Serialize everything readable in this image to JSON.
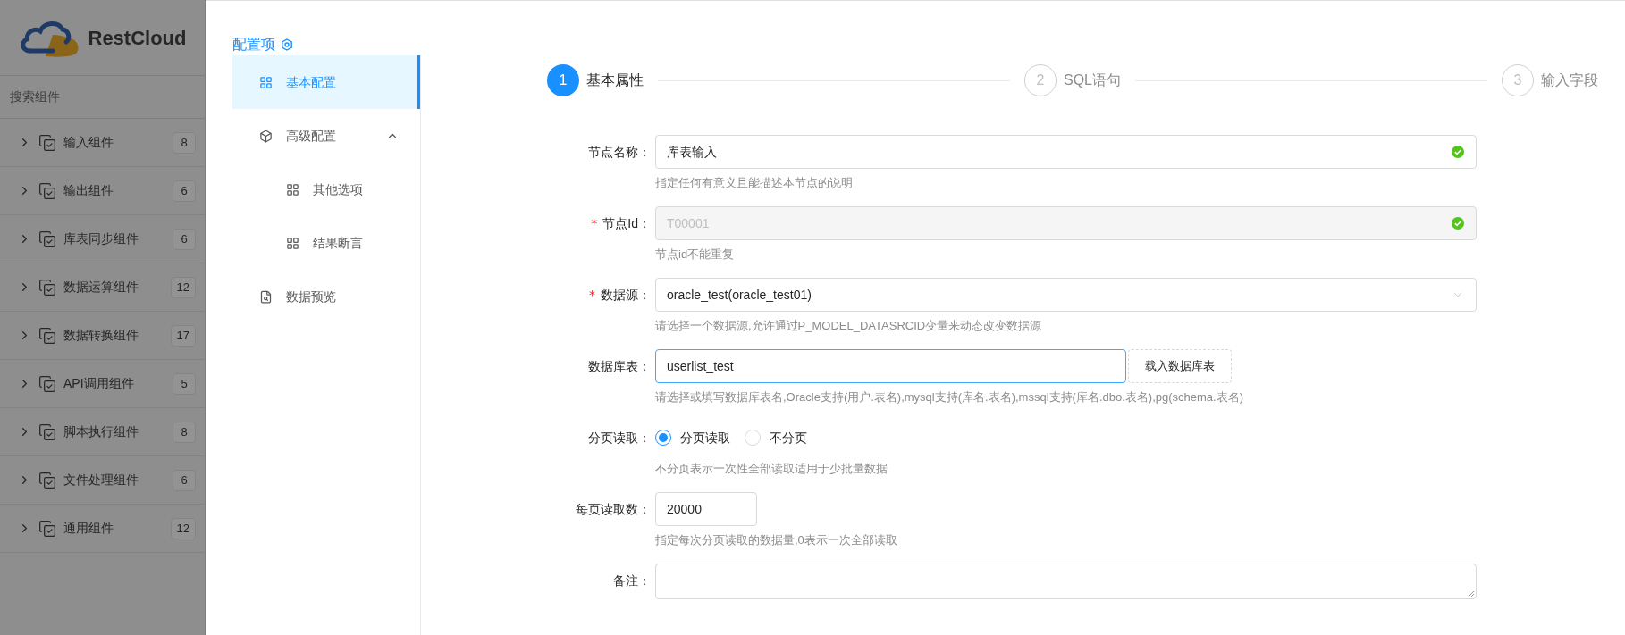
{
  "sidebar": {
    "logo_text": "RestCloud",
    "search": {
      "placeholder": "搜索组件"
    },
    "items": [
      {
        "label": "输入组件",
        "count": "8"
      },
      {
        "label": "输出组件",
        "count": "6"
      },
      {
        "label": "库表同步组件",
        "count": "6"
      },
      {
        "label": "数据运算组件",
        "count": "12"
      },
      {
        "label": "数据转换组件",
        "count": "17"
      },
      {
        "label": "API调用组件",
        "count": "5"
      },
      {
        "label": "脚本执行组件",
        "count": "8"
      },
      {
        "label": "文件处理组件",
        "count": "6"
      },
      {
        "label": "通用组件",
        "count": "12"
      }
    ]
  },
  "config_nav": {
    "title": "配置项",
    "items": [
      {
        "label": "基本配置",
        "kind": "grid",
        "selected": true
      },
      {
        "label": "高级配置",
        "kind": "cube",
        "selected": false,
        "expanded": true,
        "children": [
          {
            "label": "其他选项",
            "kind": "grid",
            "selected": false
          },
          {
            "label": "结果断言",
            "kind": "grid",
            "selected": false
          }
        ]
      },
      {
        "label": "数据预览",
        "kind": "preview",
        "selected": false
      }
    ]
  },
  "steps": [
    {
      "number": "1",
      "label": "基本属性",
      "selected": true
    },
    {
      "number": "2",
      "label": "SQL语句",
      "selected": false
    },
    {
      "number": "3",
      "label": "输入字段",
      "selected": false
    }
  ],
  "form": [
    {
      "kind": "text",
      "label": "节点名称：",
      "value": "库表输入",
      "valid": true,
      "disabled": false,
      "focused": false,
      "help": "指定任何有意义且能描述本节点的说明"
    },
    {
      "kind": "text",
      "required_mark": "*",
      "label": "节点Id：",
      "value": "T00001",
      "valid": true,
      "disabled": true,
      "focused": false,
      "help": "节点id不能重复"
    },
    {
      "kind": "select",
      "required_mark": "*",
      "label": "数据源：",
      "value": "oracle_test(oracle_test01)",
      "valid": false,
      "disabled": false,
      "focused": false,
      "help": "请选择一个数据源,允许通过P_MODEL_DATASRCID变量来动态改变数据源"
    },
    {
      "kind": "text_button",
      "label": "数据库表：",
      "value": "userlist_test",
      "valid": false,
      "disabled": false,
      "focused": true,
      "button": "载入数据库表",
      "help": "请选择或填写数据库表名,Oracle支持(用户.表名),mysql支持(库名.表名),mssql支持(库名.dbo.表名),pg(schema.表名)"
    },
    {
      "kind": "radio",
      "label": "分页读取：",
      "options": [
        {
          "label": "分页读取",
          "selected": true
        },
        {
          "label": "不分页",
          "selected": false
        }
      ],
      "help": "不分页表示一次性全部读取适用于少批量数据"
    },
    {
      "kind": "short_text",
      "label": "每页读取数：",
      "value": "20000",
      "valid": false,
      "disabled": false,
      "focused": false,
      "help": "指定每次分页读取的数据量,0表示一次全部读取"
    },
    {
      "kind": "textarea",
      "label": "备注："
    }
  ]
}
